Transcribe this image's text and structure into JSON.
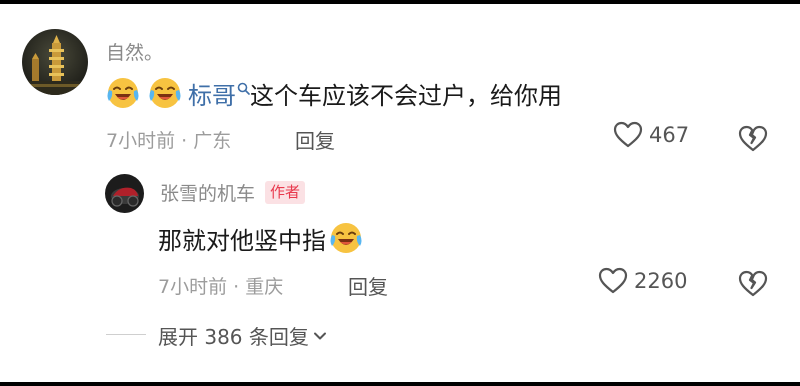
{
  "main_comment": {
    "username": "自然。",
    "mention": "标哥",
    "text": "这个车应该不会过户，给你用",
    "time_location": "7小时前 · 广东",
    "reply_label": "回复",
    "like_count": "467"
  },
  "reply_comment": {
    "username": "张雪的机车",
    "badge": "作者",
    "text": "那就对他竖中指",
    "time_location": "7小时前 · 重庆",
    "reply_label": "回复",
    "like_count": "2260"
  },
  "expand": {
    "label": "展开 386 条回复"
  },
  "colors": {
    "mention": "#3f6fa8",
    "badge_text": "#e8394d",
    "badge_bg": "#fbe1e4",
    "meta": "#9c9c9c"
  }
}
